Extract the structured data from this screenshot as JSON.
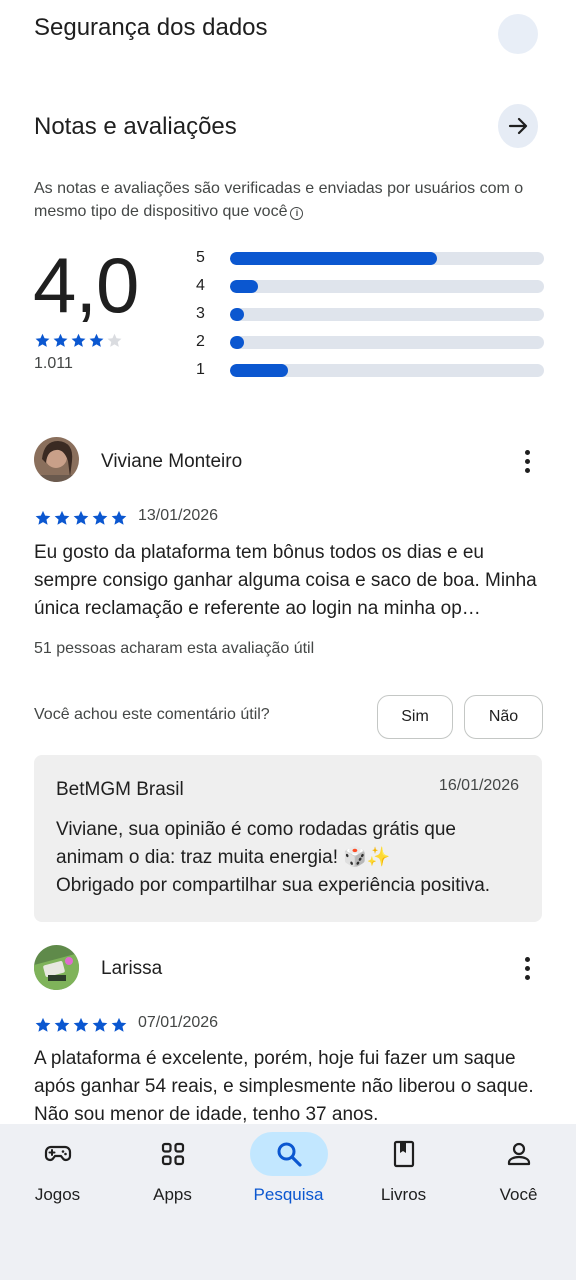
{
  "top_section_partial": {
    "title": "Segurança dos dados"
  },
  "ratings": {
    "title": "Notas e avaliações",
    "disclaimer": "As notas e avaliações são verificadas e enviadas por usuários com o mesmo tipo de dispositivo que você",
    "score": "4,0",
    "stars": 4,
    "count": "1.011",
    "distribution": [
      {
        "label": "5",
        "fraction": 0.66
      },
      {
        "label": "4",
        "fraction": 0.09
      },
      {
        "label": "3",
        "fraction": 0.045
      },
      {
        "label": "2",
        "fraction": 0.045
      },
      {
        "label": "1",
        "fraction": 0.185
      }
    ]
  },
  "reviews": [
    {
      "name": "Viviane Monteiro",
      "stars": 5,
      "date": "13/01/2026",
      "text": "Eu gosto da plataforma tem bônus todos os dias e eu sempre consigo ganhar alguma coisa e saco de boa. Minha única reclamação e referente ao login na minha op…",
      "helpful_count": "51 pessoas acharam esta avaliação útil",
      "helpful_question": "Você achou este comentário útil?",
      "yes_label": "Sim",
      "no_label": "Não",
      "developer_reply": {
        "name": "BetMGM Brasil",
        "date": "16/01/2026",
        "text": "Viviane, sua opinião é como rodadas grátis que animam o dia: traz muita energia! 🎲✨\nObrigado por compartilhar sua experiência positiva."
      }
    },
    {
      "name": "Larissa",
      "stars": 5,
      "date": "07/01/2026",
      "text": "A plataforma é excelente, porém, hoje fui fazer um saque após ganhar 54 reais, e simplesmente não liberou o saque. Não sou menor de idade, tenho 37 anos."
    }
  ],
  "bottom_nav": [
    {
      "label": "Jogos",
      "icon": "gamepad-icon",
      "active": false
    },
    {
      "label": "Apps",
      "icon": "apps-grid-icon",
      "active": false
    },
    {
      "label": "Pesquisa",
      "icon": "search-icon",
      "active": true
    },
    {
      "label": "Livros",
      "icon": "book-icon",
      "active": false
    },
    {
      "label": "Você",
      "icon": "person-icon",
      "active": false
    }
  ],
  "colors": {
    "accent": "#0b57d0",
    "track": "#dfe4ec",
    "nav_bg": "#eef0f4",
    "active_pill": "#c2e7ff"
  }
}
